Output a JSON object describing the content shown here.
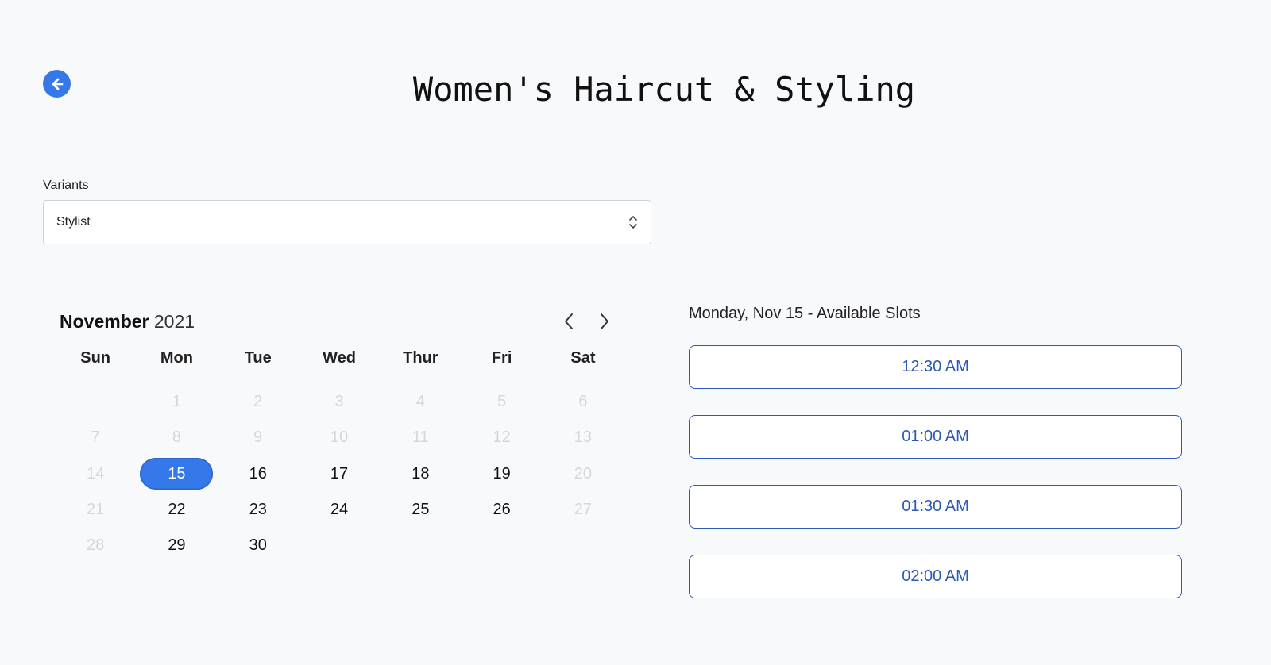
{
  "header": {
    "title": "Women's Haircut & Styling",
    "back_icon": "arrow-left-circle-icon"
  },
  "variants": {
    "label": "Variants",
    "selected": "Stylist"
  },
  "calendar": {
    "month": "November",
    "year": "2021",
    "prev_icon": "chevron-left-icon",
    "next_icon": "chevron-right-icon",
    "weekdays": [
      "Sun",
      "Mon",
      "Tue",
      "Wed",
      "Thur",
      "Fri",
      "Sat"
    ],
    "leading_blanks": 1,
    "days": [
      {
        "d": "1",
        "state": "disabled"
      },
      {
        "d": "2",
        "state": "disabled"
      },
      {
        "d": "3",
        "state": "disabled"
      },
      {
        "d": "4",
        "state": "disabled"
      },
      {
        "d": "5",
        "state": "disabled"
      },
      {
        "d": "6",
        "state": "disabled"
      },
      {
        "d": "7",
        "state": "disabled"
      },
      {
        "d": "8",
        "state": "disabled"
      },
      {
        "d": "9",
        "state": "disabled"
      },
      {
        "d": "10",
        "state": "disabled"
      },
      {
        "d": "11",
        "state": "disabled"
      },
      {
        "d": "12",
        "state": "disabled"
      },
      {
        "d": "13",
        "state": "disabled"
      },
      {
        "d": "14",
        "state": "disabled"
      },
      {
        "d": "15",
        "state": "selected"
      },
      {
        "d": "16",
        "state": "available"
      },
      {
        "d": "17",
        "state": "available"
      },
      {
        "d": "18",
        "state": "available"
      },
      {
        "d": "19",
        "state": "available"
      },
      {
        "d": "20",
        "state": "disabled"
      },
      {
        "d": "21",
        "state": "disabled"
      },
      {
        "d": "22",
        "state": "available"
      },
      {
        "d": "23",
        "state": "available"
      },
      {
        "d": "24",
        "state": "available"
      },
      {
        "d": "25",
        "state": "available"
      },
      {
        "d": "26",
        "state": "available"
      },
      {
        "d": "27",
        "state": "disabled"
      },
      {
        "d": "28",
        "state": "disabled"
      },
      {
        "d": "29",
        "state": "available"
      },
      {
        "d": "30",
        "state": "available"
      }
    ]
  },
  "slots": {
    "heading": "Monday, Nov 15 - Available Slots",
    "items": [
      "12:30 AM",
      "01:00 AM",
      "01:30 AM",
      "02:00 AM"
    ]
  },
  "colors": {
    "accent": "#3478e9",
    "slot_border": "#2b59b5",
    "background": "#f8f9fb",
    "disabled_text": "#d5d7da"
  }
}
